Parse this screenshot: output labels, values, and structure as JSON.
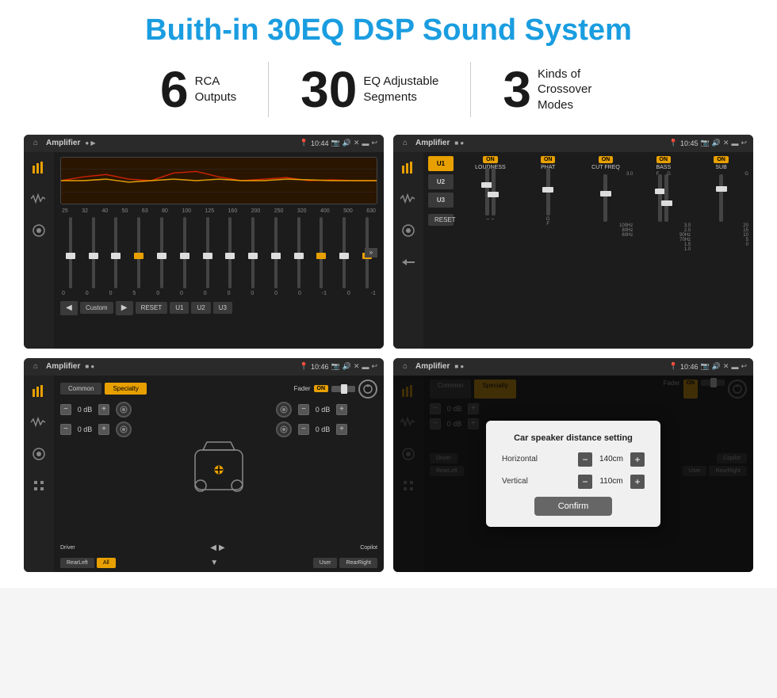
{
  "title": "Buith-in 30EQ DSP Sound System",
  "stats": [
    {
      "number": "6",
      "label_line1": "RCA",
      "label_line2": "Outputs"
    },
    {
      "number": "30",
      "label_line1": "EQ Adjustable",
      "label_line2": "Segments"
    },
    {
      "number": "3",
      "label_line1": "Kinds of",
      "label_line2": "Crossover Modes"
    }
  ],
  "screens": [
    {
      "id": "eq-screen",
      "topbar": {
        "title": "Amplifier",
        "time": "10:44"
      },
      "type": "eq",
      "freq_labels": [
        "25",
        "32",
        "40",
        "50",
        "63",
        "80",
        "100",
        "125",
        "160",
        "200",
        "250",
        "320",
        "400",
        "500",
        "630"
      ],
      "val_labels": [
        "0",
        "0",
        "0",
        "5",
        "0",
        "0",
        "0",
        "0",
        "0",
        "0",
        "0",
        "-1",
        "0",
        "-1"
      ],
      "preset_label": "Custom",
      "buttons": [
        "RESET",
        "U1",
        "U2",
        "U3"
      ]
    },
    {
      "id": "crossover-screen",
      "topbar": {
        "title": "Amplifier",
        "time": "10:45"
      },
      "type": "crossover",
      "presets": [
        "U1",
        "U2",
        "U3"
      ],
      "channels": [
        "LOUDNESS",
        "PHAT",
        "CUT FREQ",
        "BASS",
        "SUB"
      ],
      "reset_label": "RESET"
    },
    {
      "id": "fader-screen",
      "topbar": {
        "title": "Amplifier",
        "time": "10:46"
      },
      "type": "fader",
      "tabs": [
        "Common",
        "Specialty"
      ],
      "fader_label": "Fader",
      "on_label": "ON",
      "db_values": [
        "0 dB",
        "0 dB",
        "0 dB",
        "0 dB"
      ],
      "bottom_buttons": [
        "Driver",
        "Copilot",
        "RearLeft",
        "All",
        "User",
        "RearRight"
      ]
    },
    {
      "id": "dialog-screen",
      "topbar": {
        "title": "Amplifier",
        "time": "10:46"
      },
      "type": "dialog",
      "tabs": [
        "Common",
        "Specialty"
      ],
      "fader_label": "Fader",
      "on_label": "ON",
      "dialog": {
        "title": "Car speaker distance setting",
        "fields": [
          {
            "label": "Horizontal",
            "value": "140cm"
          },
          {
            "label": "Vertical",
            "value": "110cm"
          }
        ],
        "confirm_label": "Confirm"
      },
      "db_values": [
        "0 dB",
        "0 dB"
      ],
      "bottom_buttons": [
        "Driver",
        "Copilot",
        "RearLeft",
        "User",
        "RearRight"
      ]
    }
  ]
}
